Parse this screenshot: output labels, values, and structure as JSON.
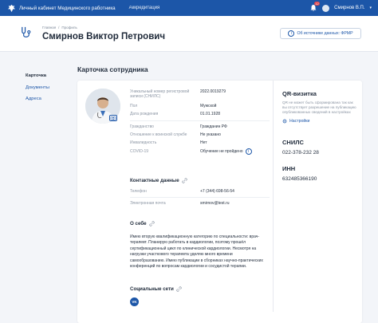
{
  "topbar": {
    "app_title": "Личный кабинет Медицинского работника",
    "nav_link": "Аккредитация",
    "notifications_count": "12",
    "user_name": "Смирнов В.П."
  },
  "header": {
    "breadcrumb": [
      "Главная",
      "/",
      "Профиль"
    ],
    "title": "Смирнов Виктор Петрович",
    "source_button": "Об источнике данных: ФРМР"
  },
  "sidebar": {
    "items": [
      {
        "label": "Карточка"
      },
      {
        "label": "Документы"
      },
      {
        "label": "Адреса"
      }
    ]
  },
  "main": {
    "section_title": "Карточка сотрудника",
    "fields": [
      {
        "key": "Уникальный номер регистровой записи (СНИЛС)",
        "value": "2022.0019279"
      },
      {
        "key": "Пол",
        "value": "Мужской"
      },
      {
        "key": "Дата рождения",
        "value": "01.01.1928"
      },
      {
        "key": "Гражданство",
        "value": "Гражданин РФ"
      },
      {
        "key": "Отношение к воинской службе",
        "value": "Не указано"
      },
      {
        "key": "Инвалидность",
        "value": "Нет"
      },
      {
        "key": "COVID-19",
        "value": "Обучение не пройдено"
      }
    ],
    "contacts_title": "Контактные данные",
    "contacts": [
      {
        "key": "Телефон",
        "value": "+7 (344) 698-56-54"
      },
      {
        "key": "Электронная почта",
        "value": "smirnov@test.ru"
      }
    ],
    "about_title": "О себе",
    "about_text": "Имею вторую квалификационную категорию по специальности: врач-терапевт. Планирую работать в кардиологии, поэтому прошёл сертификационный цикл по клинической кардиологии. Несмотря на нагрузки участкового терапевта уделяю много времени самообразованию. Имею публикации в сборниках научно-практических конференций по вопросам кардиологии и сосудистой терапии.",
    "social_title": "Социальные сети",
    "social_vk": "VK"
  },
  "right": {
    "qr_title": "QR-визитка",
    "qr_text": "QR не может быть сформирована так как вы отсутствует разрешение на публикацию опубликованных сведений в настройках",
    "settings_link": "Настройки",
    "snils_title": "СНИЛС",
    "snils_value": "022-378-232 28",
    "inn_title": "ИНН",
    "inn_value": "632485366190"
  },
  "colors": {
    "brand": "#1c56a8",
    "background": "#f3f5f9"
  }
}
